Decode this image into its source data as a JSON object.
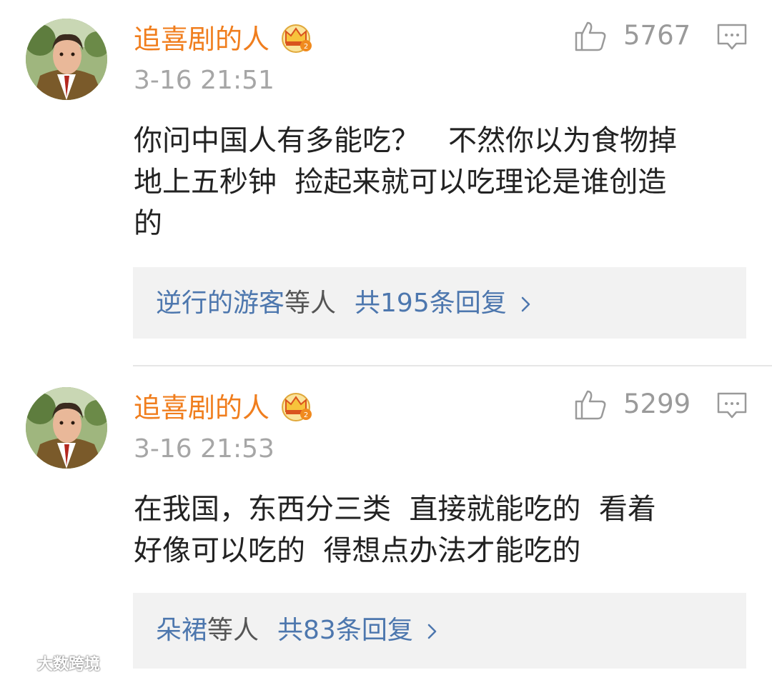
{
  "colors": {
    "username": "#f07e1e",
    "timestamp": "#a6a6a6",
    "body_text": "#222222",
    "reply_link": "#4d77ae",
    "reply_box_bg": "#f2f2f2",
    "icon_gray": "#9a9a9a"
  },
  "comments": [
    {
      "username": "追喜剧的人",
      "badge_icon": "crown-badge-icon",
      "timestamp": "3-16 21:51",
      "like_icon": "thumbs-up-icon",
      "likes": "5767",
      "reply_icon": "comment-bubble-icon",
      "text_lines": [
        "你问中国人有多能吃？　不然你以为食物掉",
        "地上五秒钟  捡起来就可以吃理论是谁创造",
        "的"
      ],
      "replies": {
        "names": "逆行的游客",
        "etc": "等人",
        "total": "共195条回复",
        "chevron_icon": "chevron-right-icon"
      }
    },
    {
      "username": "追喜剧的人",
      "badge_icon": "crown-badge-icon",
      "timestamp": "3-16 21:53",
      "like_icon": "thumbs-up-icon",
      "likes": "5299",
      "reply_icon": "comment-bubble-icon",
      "text_lines": [
        "在我国，东西分三类  直接就能吃的  看着",
        "好像可以吃的  得想点办法才能吃的"
      ],
      "replies": {
        "names": "朵裙",
        "etc": "等人",
        "total": "共83条回复",
        "chevron_icon": "chevron-right-icon"
      }
    }
  ],
  "watermark": {
    "logo_icon": "brand-logo-icon",
    "text": "大数跨境"
  }
}
